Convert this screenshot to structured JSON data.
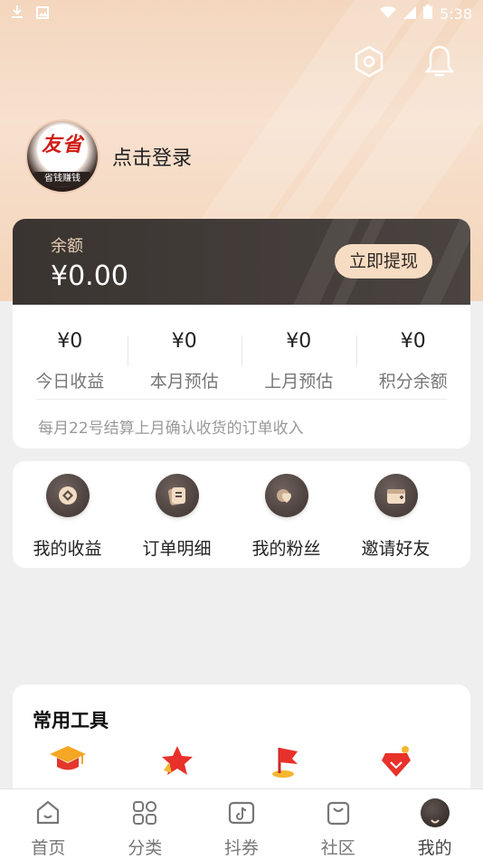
{
  "status_bar": {
    "time": "5:38",
    "left_icons": [
      "download-icon",
      "image-icon"
    ],
    "right_icons": [
      "wifi-icon",
      "signal-icon",
      "battery-icon"
    ]
  },
  "header": {
    "settings_icon": "settings-hexagon-icon",
    "notification_icon": "bell-icon"
  },
  "profile": {
    "avatar_top_text": "友省",
    "avatar_bottom_text": "省钱赚钱",
    "login_text": "点击登录"
  },
  "balance": {
    "label": "余额",
    "value": "¥0.00",
    "withdraw_label": "立即提现"
  },
  "stats": {
    "items": [
      {
        "value": "¥0",
        "label": "今日收益"
      },
      {
        "value": "¥0",
        "label": "本月预估"
      },
      {
        "value": "¥0",
        "label": "上月预估"
      },
      {
        "value": "¥0",
        "label": "积分余额"
      }
    ],
    "note": "每月22号结算上月确认收货的订单收入"
  },
  "menu": {
    "items": [
      {
        "label": "我的收益",
        "icon": "coin-icon"
      },
      {
        "label": "订单明细",
        "icon": "order-icon"
      },
      {
        "label": "我的粉丝",
        "icon": "fans-icon"
      },
      {
        "label": "邀请好友",
        "icon": "invite-icon"
      }
    ]
  },
  "tools": {
    "title": "常用工具",
    "icons": [
      "graduation-cap-icon",
      "star-icon",
      "flag-icon",
      "gem-icon"
    ]
  },
  "tabbar": {
    "items": [
      {
        "label": "首页",
        "icon": "home-icon"
      },
      {
        "label": "分类",
        "icon": "grid-icon"
      },
      {
        "label": "抖券",
        "icon": "douyin-icon"
      },
      {
        "label": "社区",
        "icon": "bag-icon"
      },
      {
        "label": "我的",
        "icon": "me-icon"
      }
    ],
    "active_index": 4
  },
  "colors": {
    "hero_bg": "#f3d6bd",
    "card_dark": "#3a3431",
    "accent_gold": "#e8cfb5",
    "withdraw_bg": "#f6dcc2"
  }
}
